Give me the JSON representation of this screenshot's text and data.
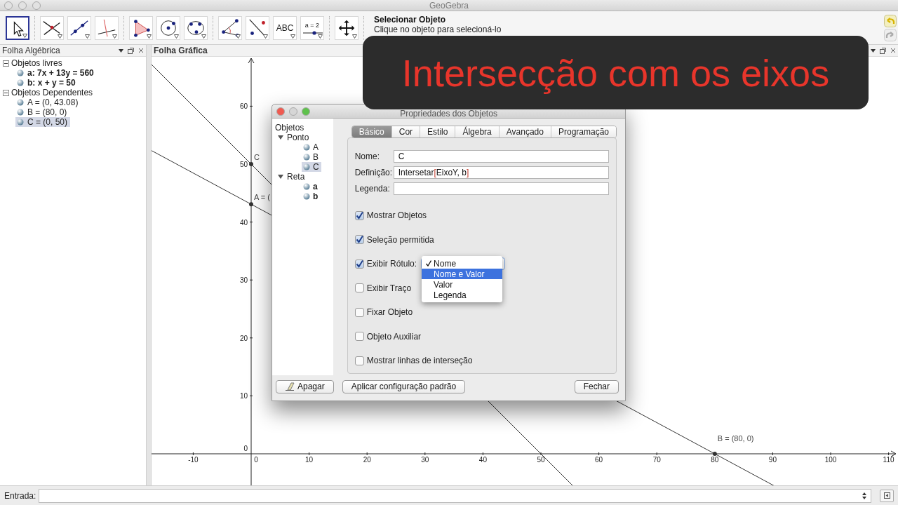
{
  "window": {
    "title": "GeoGebra"
  },
  "toolbar": {
    "tool_groups": [
      [
        {
          "kind": "move",
          "selected": true
        }
      ],
      [
        {
          "kind": "intersect",
          "selected": false
        },
        {
          "kind": "line",
          "selected": false
        },
        {
          "kind": "perpendicular",
          "selected": false
        }
      ],
      [
        {
          "kind": "polygon",
          "selected": false
        },
        {
          "kind": "circle",
          "selected": false
        },
        {
          "kind": "conic",
          "selected": false
        }
      ],
      [
        {
          "kind": "angle",
          "selected": false
        },
        {
          "kind": "reflect",
          "selected": false
        },
        {
          "kind": "text",
          "label": "ABC",
          "selected": false
        },
        {
          "kind": "slider",
          "label": "a = 2",
          "selected": false
        }
      ],
      [
        {
          "kind": "pan",
          "selected": false
        }
      ]
    ],
    "tool_name": "Selecionar Objeto",
    "tool_hint": "Clique no objeto para selecioná-lo"
  },
  "algebra": {
    "title": "Folha Algébrica",
    "groups": [
      {
        "label": "Objetos livres",
        "kind": "free",
        "expanded": true,
        "children": [
          {
            "label": "a: 7x + 13y = 560",
            "selected": false
          },
          {
            "label": "b: x + y = 50",
            "selected": false
          }
        ]
      },
      {
        "label": "Objetos Dependentes",
        "kind": "dependent",
        "expanded": true,
        "children": [
          {
            "label": "A = (0, 43.08)",
            "selected": false
          },
          {
            "label": "B = (80, 0)",
            "selected": false
          },
          {
            "label": "C = (0, 50)",
            "selected": true
          }
        ]
      }
    ]
  },
  "graphics": {
    "title": "Folha Gráfica",
    "x_ticks": [
      "-10",
      "0",
      "10",
      "20",
      "30",
      "40",
      "50",
      "60",
      "70",
      "80",
      "90",
      "100",
      "110"
    ],
    "y_ticks": [
      "60",
      "50",
      "40",
      "30",
      "20",
      "10",
      "0"
    ],
    "point_labels": [
      {
        "text": "C"
      },
      {
        "text": "A = ("
      },
      {
        "text": "B = (80, 0)"
      }
    ]
  },
  "caption": {
    "text": "Intersecção com os eixos"
  },
  "dialog": {
    "title": "Propriedades dos Objetos",
    "tree": {
      "label": "Objetos",
      "children": [
        {
          "label": "Ponto",
          "kind": "point",
          "expanded": true,
          "children": [
            {
              "label": "A",
              "selected": false
            },
            {
              "label": "B",
              "selected": false
            },
            {
              "label": "C",
              "selected": true
            }
          ]
        },
        {
          "label": "Reta",
          "kind": "line",
          "expanded": true,
          "children": [
            {
              "label": "a",
              "selected": false
            },
            {
              "label": "b",
              "selected": false
            }
          ]
        }
      ]
    },
    "tabs": [
      {
        "label": "Básico",
        "selected": true
      },
      {
        "label": "Cor",
        "selected": false
      },
      {
        "label": "Estilo",
        "selected": false
      },
      {
        "label": "Álgebra",
        "selected": false
      },
      {
        "label": "Avançado",
        "selected": false
      },
      {
        "label": "Programação",
        "selected": false
      }
    ],
    "fields": [
      {
        "label": "Nome:",
        "value_parts": [
          {
            "text": "C",
            "kind": "plain"
          }
        ]
      },
      {
        "label": "Definição:",
        "value_parts": [
          {
            "text": "Intersetar",
            "kind": "plain"
          },
          {
            "text": "[",
            "kind": "bracket"
          },
          {
            "text": "EixoY, b",
            "kind": "plain"
          },
          {
            "text": "]",
            "kind": "bracket"
          }
        ]
      },
      {
        "label": "Legenda:"
      }
    ],
    "checkboxes": [
      {
        "label": "Mostrar Objetos",
        "checked": true
      },
      {
        "label": "Seleção permitida",
        "checked": true
      },
      {
        "label": "Exibir Rótulo:",
        "checked": true,
        "kind": "dropdown"
      },
      {
        "label": "Exibir Traço",
        "checked": false
      },
      {
        "label": "Fixar Objeto",
        "checked": false
      },
      {
        "label": "Objeto Auxiliar",
        "checked": false
      },
      {
        "label": "Mostrar linhas de interseção",
        "checked": false
      }
    ],
    "label_menu": [
      {
        "label": "Nome",
        "checked": true,
        "highlighted": false
      },
      {
        "label": "Nome e Valor",
        "checked": false,
        "highlighted": true
      },
      {
        "label": "Valor",
        "checked": false,
        "highlighted": false
      },
      {
        "label": "Legenda",
        "checked": false,
        "highlighted": false
      }
    ],
    "buttons": [
      {
        "label": "Apagar",
        "kind": "erase"
      },
      {
        "label": "Aplicar configuração padrão",
        "kind": "plain"
      },
      {
        "label": "Fechar",
        "kind": "plain"
      }
    ]
  },
  "input_bar": {
    "label": "Entrada:"
  }
}
